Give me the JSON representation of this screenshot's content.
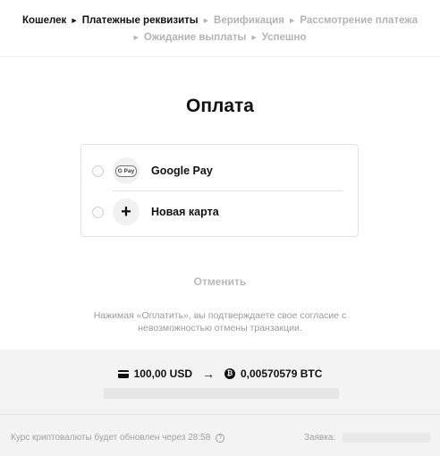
{
  "breadcrumbs": {
    "row1": [
      {
        "label": "Кошелек",
        "state": "done"
      },
      {
        "label": "Платежные реквизиты",
        "state": "done"
      },
      {
        "label": "Верификация",
        "state": "todo"
      },
      {
        "label": "Рассмотрение платежа",
        "state": "todo"
      }
    ],
    "row2": [
      {
        "label": "Ожидание выплаты",
        "state": "todo"
      },
      {
        "label": "Успешно",
        "state": "todo"
      }
    ]
  },
  "page": {
    "title": "Оплата"
  },
  "payment_methods": [
    {
      "label": "Google Pay",
      "icon": "google-pay-icon",
      "icon_text": "G Pay",
      "selected": false
    },
    {
      "label": "Новая карта",
      "icon": "plus-icon",
      "icon_text": "+",
      "selected": false
    }
  ],
  "actions": {
    "cancel_label": "Отменить"
  },
  "disclaimer": {
    "line1": "Нажимая «Оплатить», вы подтверждаете свое согласие с",
    "line2": "невозможностью отмены транзакции."
  },
  "summary": {
    "from_amount": "100,00 USD",
    "to_amount": "0,00570579 BTC",
    "arrow": "→",
    "btc_symbol": "₿"
  },
  "footer": {
    "rate_note": "Курс криптовалюты будет обновлен через 28:58",
    "help_symbol": "?",
    "order_label": "Заявка:"
  },
  "colors": {
    "text": "#111111",
    "muted": "#b3b3b3",
    "summary_bg": "#f3f3f3"
  }
}
